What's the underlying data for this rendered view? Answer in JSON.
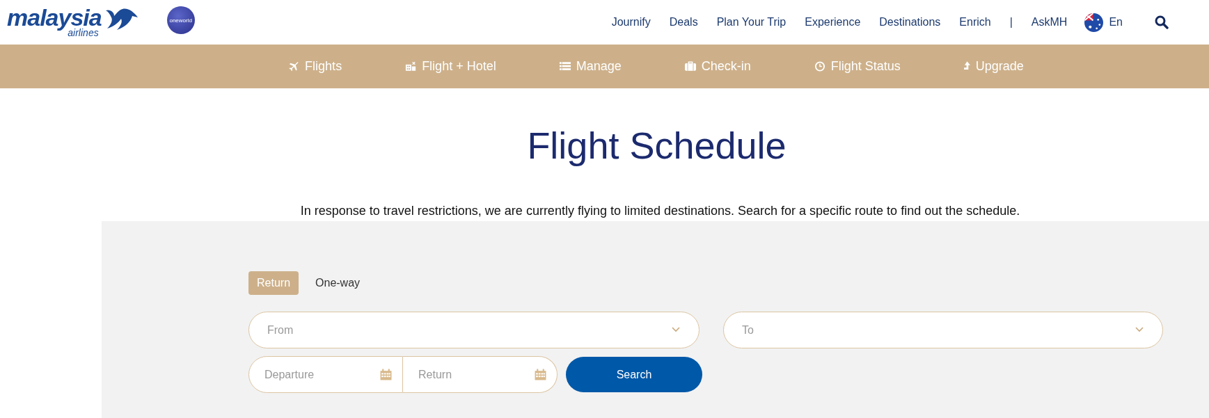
{
  "logo": {
    "word": "malaysia",
    "sub": "airlines"
  },
  "partner_logo": {
    "text": "oneworld"
  },
  "top_nav": [
    "Journify",
    "Deals",
    "Plan Your Trip",
    "Experience",
    "Destinations",
    "Enrich",
    "|",
    "AskMH"
  ],
  "language": "En",
  "main_nav": [
    {
      "label": "Flights"
    },
    {
      "label": "Flight + Hotel"
    },
    {
      "label": "Manage"
    },
    {
      "label": "Check-in"
    },
    {
      "label": "Flight Status"
    },
    {
      "label": "Upgrade"
    }
  ],
  "title": "Flight Schedule",
  "notice": "In response to travel restrictions, we are currently flying to limited destinations. Search for a specific route to find out the schedule.",
  "trip_tabs": [
    {
      "label": "Return",
      "selected": true
    },
    {
      "label": "One-way",
      "selected": false
    }
  ],
  "from": {
    "placeholder": "From"
  },
  "to": {
    "placeholder": "To"
  },
  "departure": {
    "placeholder": "Departure"
  },
  "return_date": {
    "placeholder": "Return"
  },
  "search_button": "Search"
}
